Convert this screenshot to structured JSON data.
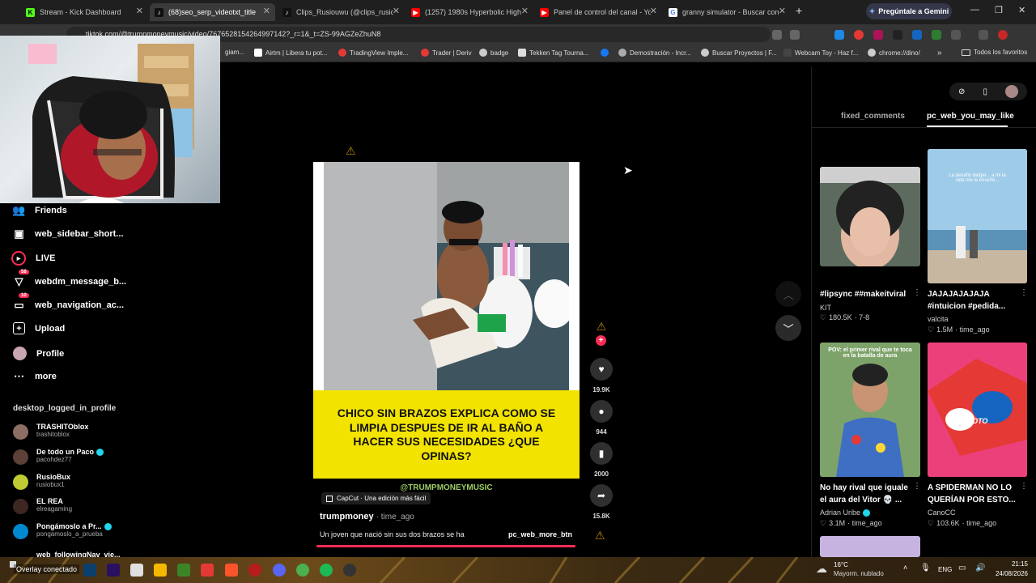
{
  "browser": {
    "tabs": [
      {
        "title": "Stream - Kick Dashboard",
        "favicon_color": "#53fc18",
        "icon": "kick-icon"
      },
      {
        "title": "(68)seo_serp_videotxt_title",
        "favicon_color": "#111111",
        "icon": "tiktok-icon",
        "active": true
      },
      {
        "title": "Clips_Rusiouwu (@clips_rusiou",
        "favicon_color": "#111111",
        "icon": "tiktok-icon"
      },
      {
        "title": "(1257) 1980s Hyperbolic High",
        "favicon_color": "#ff0000",
        "icon": "youtube-icon"
      },
      {
        "title": "Panel de control del canal - You",
        "favicon_color": "#ff0000",
        "icon": "youtube-icon"
      },
      {
        "title": "granny simulator - Buscar con",
        "favicon_color": "#4285f4",
        "icon": "google-icon"
      }
    ],
    "gemini_label": "Pregúntale a Gemini",
    "url": "tiktok.com/@trumpmoneymusic/video/7676528154264997142?_r=1&_t=ZS-99AGZeZhuN8",
    "bookmarks": [
      {
        "label": "giam...",
        "color": "#888888"
      },
      {
        "label": "Airtm | Libera tu pot...",
        "color": "#ffffff"
      },
      {
        "label": "TradingView Imple...",
        "color": "#e53935"
      },
      {
        "label": "Trader | Deriv",
        "color": "#e53935"
      },
      {
        "label": "badge",
        "color": "#cccccc"
      },
      {
        "label": "Tekken Tag Tourna...",
        "color": "#dddddd"
      },
      {
        "label": "",
        "color": "#1877f2"
      },
      {
        "label": "Demostración - Incr...",
        "color": "#aaaaaa"
      },
      {
        "label": "Buscar Proyectos | F...",
        "color": "#cccccc"
      },
      {
        "label": "Webcam Toy - Haz f...",
        "color": "#444444"
      },
      {
        "label": "chrome://dino/",
        "color": "#cccccc"
      }
    ],
    "bookmarks_more": "»",
    "all_favorites": "Todos los favoritos"
  },
  "sidebar": {
    "items": [
      {
        "label": "Friends",
        "icon": "friends-icon"
      },
      {
        "label": "web_sidebar_short...",
        "icon": "shorts-icon"
      },
      {
        "label": "LIVE",
        "icon": "live-icon"
      },
      {
        "label": "webdm_message_b...",
        "icon": "message-icon",
        "badge": "58"
      },
      {
        "label": "web_navigation_ac...",
        "icon": "activity-icon",
        "badge": "10"
      },
      {
        "label": "Upload",
        "icon": "upload-icon"
      },
      {
        "label": "Profile",
        "icon": "profile-icon"
      },
      {
        "label": "more",
        "icon": "more-icon"
      }
    ],
    "following_header": "desktop_logged_in_profile",
    "following": [
      {
        "name": "TRASHITOblox",
        "user": "trashitoblox",
        "color": "#8d6e63"
      },
      {
        "name": "De todo un Paco",
        "user": "pacohdez77",
        "color": "#5d4037",
        "verified": true
      },
      {
        "name": "RusioBux",
        "user": "rusiobux1",
        "color": "#c0ca33"
      },
      {
        "name": "EL REA",
        "user": "elreagaming",
        "color": "#3e2723"
      },
      {
        "name": "Pongámoslo a Pr...",
        "user": "pongamoslo_a_prueba",
        "color": "#0288d1",
        "verified": true
      },
      {
        "name": "web_followingNav_vie...",
        "user": "",
        "color": "#222222"
      }
    ]
  },
  "video": {
    "caption_yellow": "CHICO SIN BRAZOS EXPLICA COMO SE LIMPIA DESPUES DE IR AL BAÑO A HACER SUS NECESIDADES ¿QUE OPINAS?",
    "watermark": "@TRUMPMONEYMUSIC",
    "capcut_label": "CapCut · Una edición más fácil",
    "author": "trumpmoney",
    "time": "· time_ago",
    "description": "Un joven que nació sin sus dos brazos se ha",
    "more_btn": "pc_web_more_btn",
    "likes": "19.9K",
    "comments": "944",
    "saves": "2000",
    "shares": "15.8K"
  },
  "right_panel": {
    "tabs": [
      "fixed_comments",
      "pc_web_you_may_like"
    ],
    "active_tab": "pc_web_you_may_like",
    "cards": [
      {
        "title1": "#lipsync ##makeitviral",
        "title2": "",
        "author": "KIT",
        "likes": "180.5K",
        "time": "· 7-8",
        "color": "#5d6b5f"
      },
      {
        "title1": "JAJAJAJAJAJA",
        "title2": "#intuicion #pedida...",
        "author": "valcita",
        "likes": "1.5M",
        "time": "· time_ago",
        "color": "#7fb3d5"
      },
      {
        "title1": "No hay rival que iguale",
        "title2": "el aura del Vitor 💀 ...",
        "author": "Adrian Uribe",
        "likes": "3.1M",
        "time": "· time_ago",
        "color": "#6d8f5f",
        "verified": true
      },
      {
        "title1": "A SPIDERMAN NO LO",
        "title2": "QUERÍAN POR ESTO...",
        "author": "CanoCC",
        "likes": "103.6K",
        "time": "· time_ago",
        "color": "#d81b60"
      }
    ],
    "thumb_text": {
      "card3": "POV: el primer rival que te toca en la batalla de aura",
      "card4": "NOTO",
      "card2": "La desafío delgar... a mi la vida me la enseñó..."
    }
  },
  "taskbar": {
    "overlay_text": "Overlay conectado",
    "weather_temp": "16°C",
    "weather_desc": "Mayorm. nublado",
    "lang": "ENG",
    "time": "21:15",
    "date": "24/08/2026"
  }
}
